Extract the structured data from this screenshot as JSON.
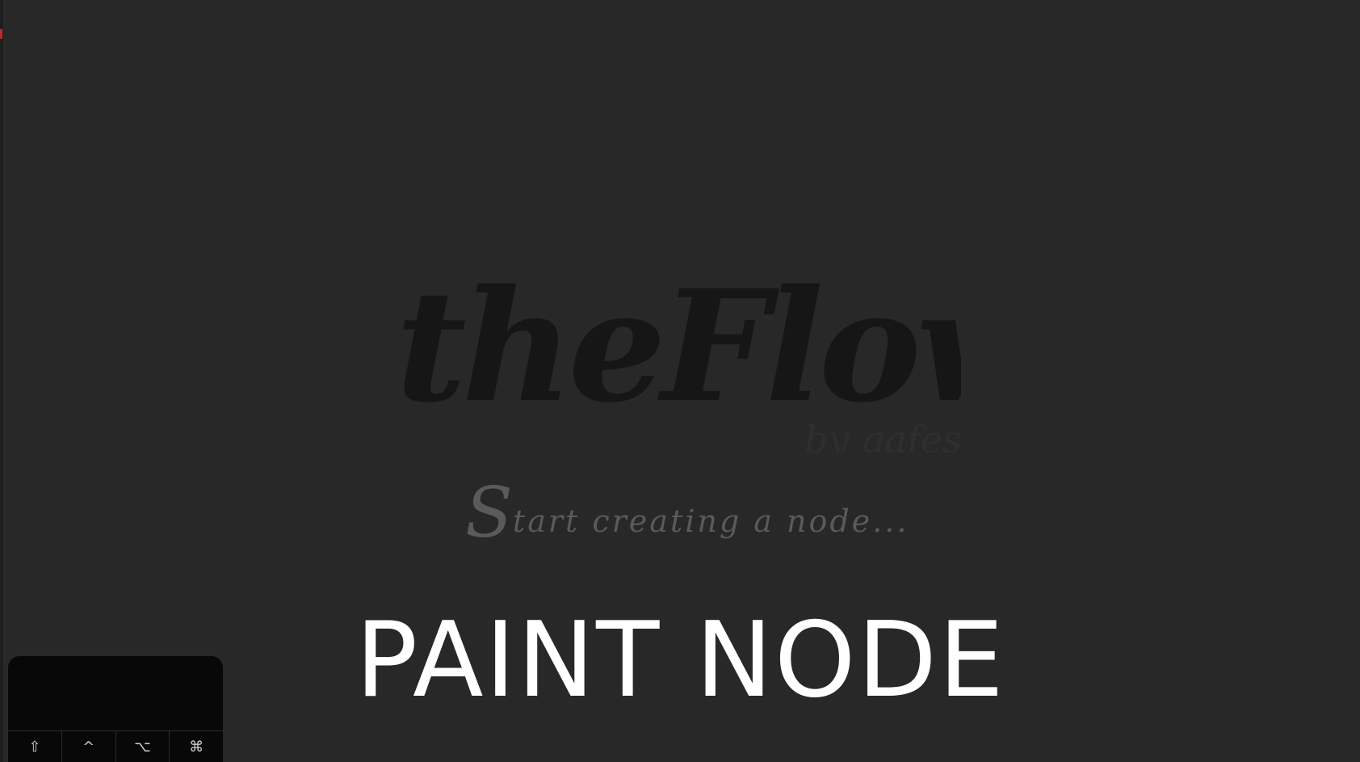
{
  "logo": {
    "title": "theFlow!",
    "byline": "by gafes",
    "main_color": "#161616",
    "byline_color": "#2f2f2f"
  },
  "hint": {
    "first_letter": "S",
    "rest": "tart creating a node..."
  },
  "current_node": "PAINT NODE",
  "modifier_keys": [
    {
      "name": "shift",
      "glyph": "⇧"
    },
    {
      "name": "control",
      "glyph": "^"
    },
    {
      "name": "option",
      "glyph": "⌥"
    },
    {
      "name": "command",
      "glyph": "⌘"
    }
  ],
  "colors": {
    "canvas": "#282828",
    "hint_text": "#5a5a5a",
    "node_label": "#ffffff",
    "key_panel": "#080808",
    "edge_accent": "#c62828"
  }
}
